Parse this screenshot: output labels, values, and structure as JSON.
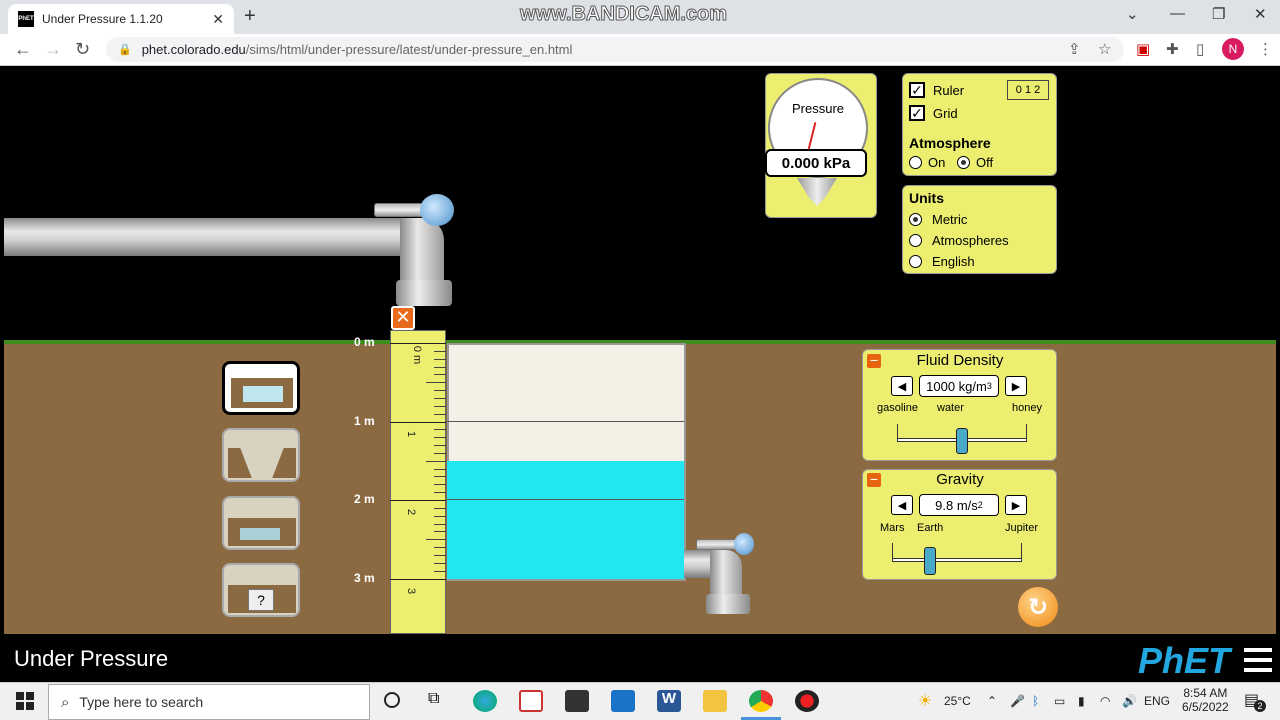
{
  "browser": {
    "tab_title": "Under Pressure 1.1.20",
    "tab_favicon": "PhET",
    "url_domain": "phet.colorado.edu",
    "url_path": "/sims/html/under-pressure/latest/under-pressure_en.html",
    "watermark": "www.BANDICAM.com",
    "profile_initial": "N"
  },
  "sim": {
    "title": "Under Pressure",
    "gauge": {
      "label": "Pressure",
      "value": "0.000 kPa"
    },
    "options": {
      "ruler_label": "Ruler",
      "grid_label": "Grid",
      "ruler_icon_text": "0 1 2",
      "atmosphere_title": "Atmosphere",
      "atmosphere_on": "On",
      "atmosphere_off": "Off",
      "atmosphere_selected": "Off"
    },
    "units": {
      "title": "Units",
      "options": [
        "Metric",
        "Atmospheres",
        "English"
      ],
      "selected": "Metric"
    },
    "ruler_labels": [
      "0 m",
      "1 m",
      "2 m",
      "3 m"
    ],
    "ruler_ticks": [
      "0 m",
      "1",
      "2",
      "3"
    ],
    "fluid_density": {
      "title": "Fluid Density",
      "value": "1000 kg/m",
      "value_sup": "3",
      "labels": [
        "gasoline",
        "water",
        "honey"
      ],
      "level": 0.5
    },
    "gravity": {
      "title": "Gravity",
      "value": "9.8 m/s",
      "value_sup": "2",
      "labels": [
        "Mars",
        "Earth",
        "Jupiter"
      ],
      "level": 0.29
    },
    "scene_mystery_label": "?",
    "water_level_m": 2.0
  },
  "taskbar": {
    "search_placeholder": "Type here to search",
    "weather": "25°C",
    "lang": "ENG",
    "time": "8:54 AM",
    "date": "6/5/2022",
    "notif_count": "2"
  },
  "colors": {
    "panel": "#ecee6f",
    "water": "#22e6f2",
    "ground": "#8b6a42",
    "grass": "#3e8e1e",
    "phet_blue": "#22a7e0"
  }
}
